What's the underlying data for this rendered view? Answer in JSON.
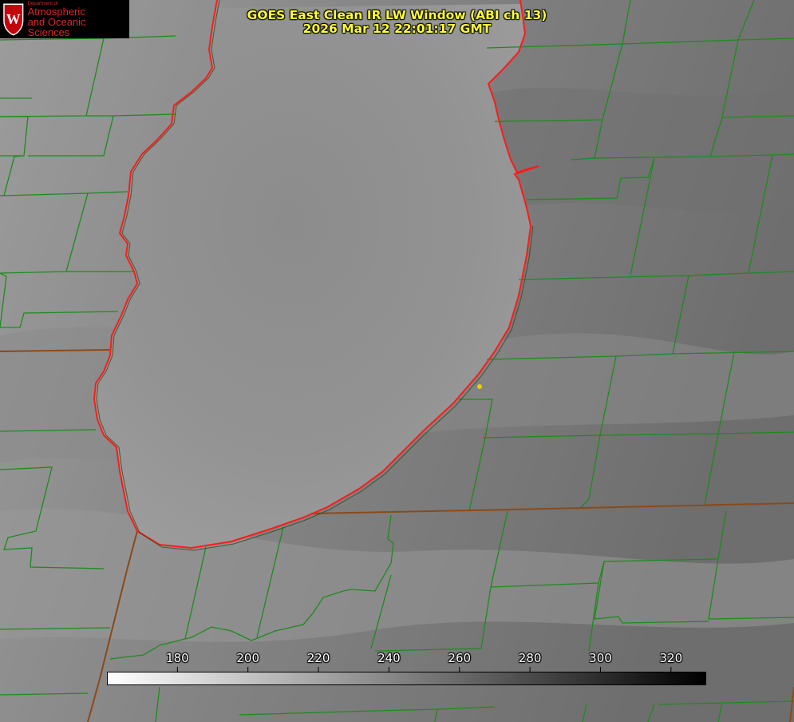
{
  "title": {
    "line1": "GOES East Clean IR LW Window (ABI ch 13)",
    "line2": "2026 Mar 12 22:01:17 GMT"
  },
  "logo": {
    "icon": "uw-crest-icon",
    "department": "Department of",
    "line1": "Atmospheric",
    "line2": "and Oceanic Sciences"
  },
  "colorbar": {
    "unit_range": [
      160,
      330
    ],
    "tick_labels": [
      "180",
      "200",
      "220",
      "240",
      "260",
      "280",
      "300",
      "320"
    ],
    "tick_values": [
      180,
      200,
      220,
      240,
      260,
      280,
      300,
      320
    ],
    "gradient_start": "#ffffff",
    "gradient_end": "#000000"
  },
  "colors": {
    "title": "#ffff33",
    "county_lines": "#1f8a1f",
    "state_lines": "#8a4a1a",
    "lake_shoreline": "#ff1a1a",
    "station_marker": "#e8d000"
  },
  "map": {
    "features": [
      "lake-outline",
      "county-boundaries",
      "state-boundary",
      "station-marker"
    ]
  }
}
